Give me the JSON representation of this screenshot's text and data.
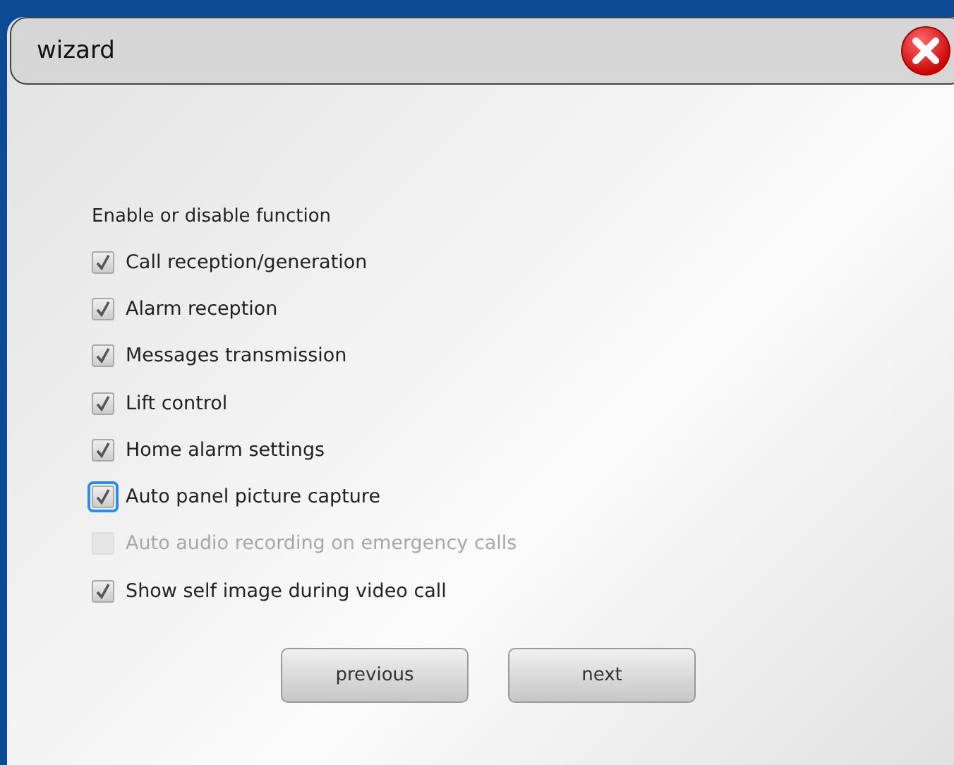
{
  "window": {
    "title": "wizard"
  },
  "section": {
    "label": "Enable or disable function"
  },
  "options": [
    {
      "label": "Call reception/generation",
      "checked": true,
      "disabled": false,
      "focused": false
    },
    {
      "label": "Alarm reception",
      "checked": true,
      "disabled": false,
      "focused": false
    },
    {
      "label": "Messages transmission",
      "checked": true,
      "disabled": false,
      "focused": false
    },
    {
      "label": "Lift control",
      "checked": true,
      "disabled": false,
      "focused": false
    },
    {
      "label": "Home alarm settings",
      "checked": true,
      "disabled": false,
      "focused": false
    },
    {
      "label": "Auto panel picture capture",
      "checked": true,
      "disabled": false,
      "focused": true
    },
    {
      "label": "Auto audio recording on emergency calls",
      "checked": false,
      "disabled": true,
      "focused": false
    },
    {
      "label": "Show self image during video call",
      "checked": true,
      "disabled": false,
      "focused": false
    }
  ],
  "buttons": [
    {
      "label": "previous"
    },
    {
      "label": "next"
    }
  ]
}
